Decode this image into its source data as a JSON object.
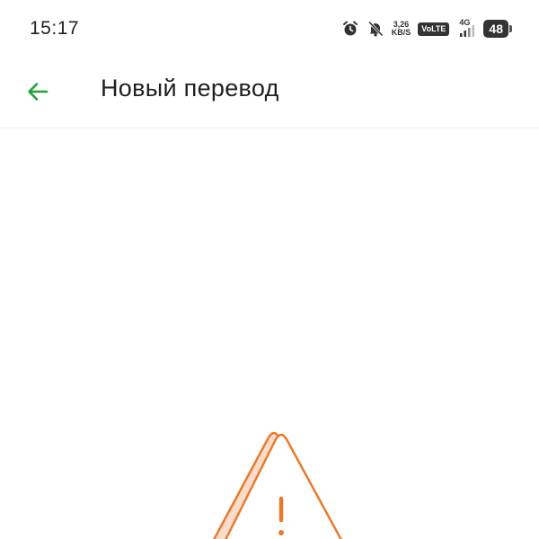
{
  "status_bar": {
    "time": "15:17",
    "net_speed_value": "3,26",
    "net_speed_unit": "KB/S",
    "volte": "VoLTE",
    "network_type": "4G",
    "battery_level": "48",
    "icons": [
      "alarm-icon",
      "bell-off-icon",
      "signal-icon",
      "battery-icon"
    ]
  },
  "app_bar": {
    "title": "Новый перевод",
    "back_icon": "arrow-left-icon",
    "accent_color": "#21a038"
  },
  "content": {
    "illustration": "warning-triangle-icon",
    "illustration_color": "#e87a2c",
    "illustration_fill": "#fbdccb"
  }
}
